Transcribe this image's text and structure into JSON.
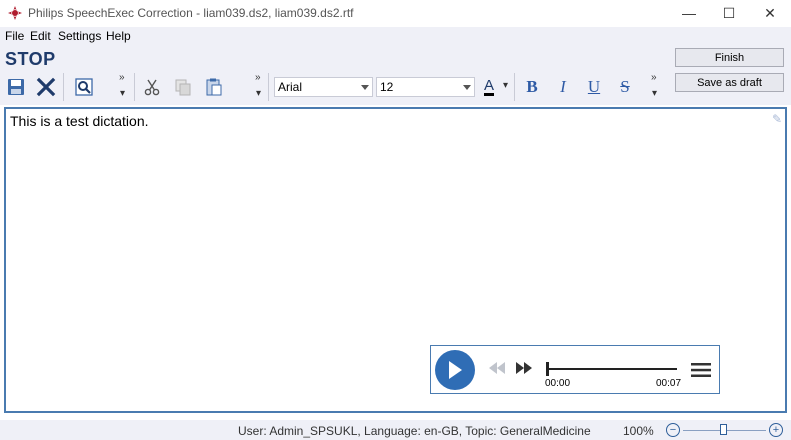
{
  "window": {
    "title": "Philips SpeechExec Correction - liam039.ds2, liam039.ds2.rtf",
    "minimize_glyph": "—",
    "maximize_glyph": "☐",
    "close_glyph": "✕"
  },
  "menu": {
    "items": [
      {
        "label": "File"
      },
      {
        "label": "Edit"
      },
      {
        "label": "Settings"
      },
      {
        "label": "Help"
      }
    ]
  },
  "toolbar": {
    "status": "STOP",
    "overflow_glyph": "»",
    "font_name": "Arial",
    "font_size": "12",
    "bold_label": "B",
    "italic_label": "I",
    "underline_label": "U",
    "strike_label": "S",
    "font_color": "A",
    "finish_label": "Finish",
    "save_draft_label": "Save as draft",
    "icons": [
      "save-icon",
      "close-icon",
      "search-icon",
      "cut-icon",
      "copy-icon",
      "paste-icon",
      "font-color-icon"
    ]
  },
  "editor": {
    "content": "This is a test dictation."
  },
  "player": {
    "time_start": "00:00",
    "time_end": "00:07",
    "position": 0.0
  },
  "statusbar": {
    "info": "User:  Admin_SPSUKL, Language:  en-GB, Topic:  GeneralMedicine",
    "zoom": "100%",
    "zoom_minus": "−",
    "zoom_plus": "+"
  },
  "colors": {
    "accent": "#2f6db5",
    "title_blue": "#1f3b6b",
    "toolbar_bg": "#eff0f7",
    "format_blue": "#2e5aa5"
  }
}
